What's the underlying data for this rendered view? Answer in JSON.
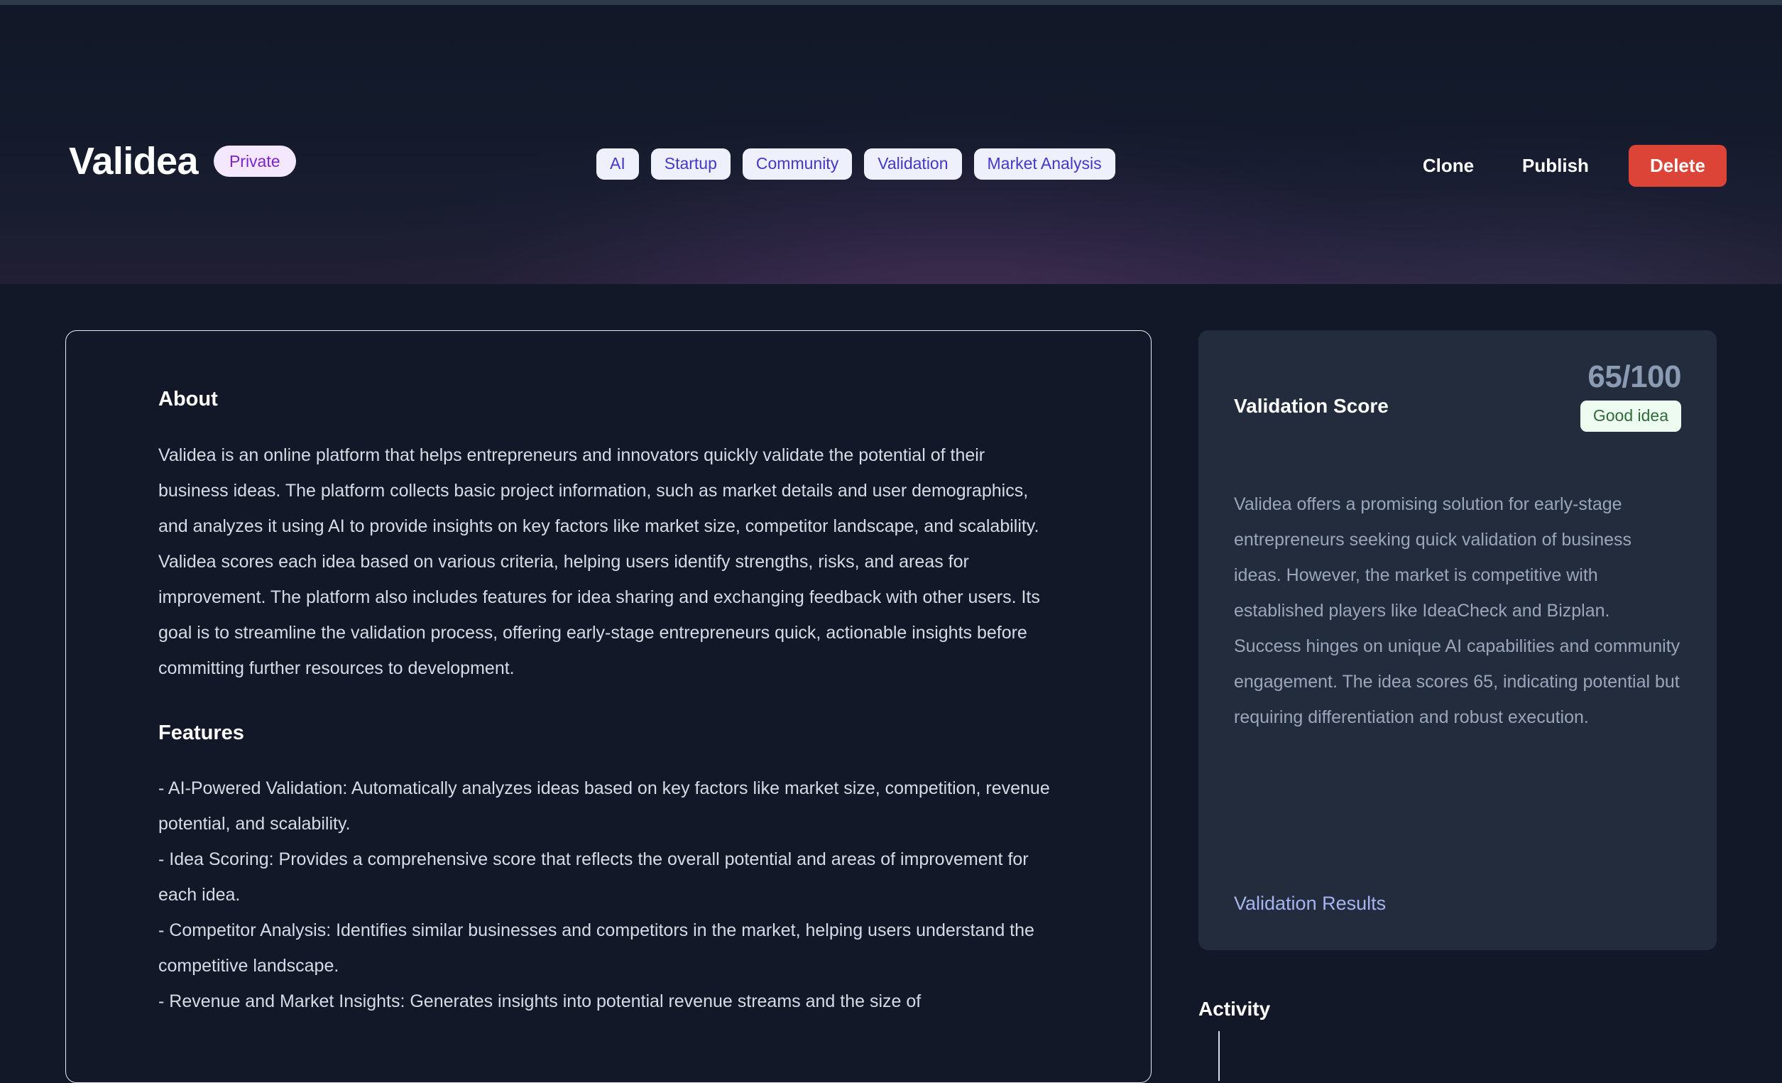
{
  "window": {
    "background_color": "#121827",
    "header_glow_color": "#9b5aaa"
  },
  "header": {
    "title": "Validea",
    "visibility_badge": "Private",
    "tags": [
      {
        "label": "AI"
      },
      {
        "label": "Startup"
      },
      {
        "label": "Community"
      },
      {
        "label": "Validation"
      },
      {
        "label": "Market Analysis"
      }
    ],
    "tag_bg_color": "#eef0fb",
    "tag_text_color": "#4338ca",
    "badge_bg_color": "#f3e8ff",
    "badge_text_color": "#7e22ce",
    "actions": {
      "clone_label": "Clone",
      "publish_label": "Publish",
      "delete_label": "Delete",
      "delete_color": "#dc4437"
    }
  },
  "main": {
    "about_heading": "About",
    "about_text": "Validea is an online platform that helps entrepreneurs and innovators quickly validate the potential of their business ideas. The platform collects basic project information, such as market details and user demographics, and analyzes it using AI to provide insights on key factors like market size, competitor landscape, and scalability. Validea scores each idea based on various criteria, helping users identify strengths, risks, and areas for improvement. The platform also includes features for idea sharing and exchanging feedback with other users. Its goal is to streamline the validation process, offering early-stage entrepreneurs quick, actionable insights before committing further resources to development.",
    "features_heading": "Features",
    "features": [
      "- AI-Powered Validation: Automatically analyzes ideas based on key factors like market size, competition, revenue potential, and scalability.",
      "- Idea Scoring: Provides a comprehensive score that reflects the overall potential and areas of improvement for each idea.",
      "- Competitor Analysis: Identifies similar businesses and competitors in the market, helping users understand the competitive landscape.",
      "- Revenue and Market Insights: Generates insights into potential revenue streams and the size of"
    ]
  },
  "sidebar": {
    "score_card": {
      "label": "Validation Score",
      "score": "65/100",
      "verdict_badge": "Good idea",
      "verdict_bg_color": "#eefbf0",
      "verdict_text_color": "#2d6b38",
      "summary": "Validea offers a promising solution for early-stage entrepreneurs seeking quick validation of business ideas. However, the market is competitive with established players like IdeaCheck and Bizplan. Success hinges on unique AI capabilities and community engagement. The idea scores 65, indicating potential but requiring differentiation and robust execution.",
      "results_link": "Validation Results",
      "results_link_color": "#a7b4f0",
      "card_bg_color": "#232c3d"
    },
    "activity": {
      "title": "Activity"
    }
  }
}
